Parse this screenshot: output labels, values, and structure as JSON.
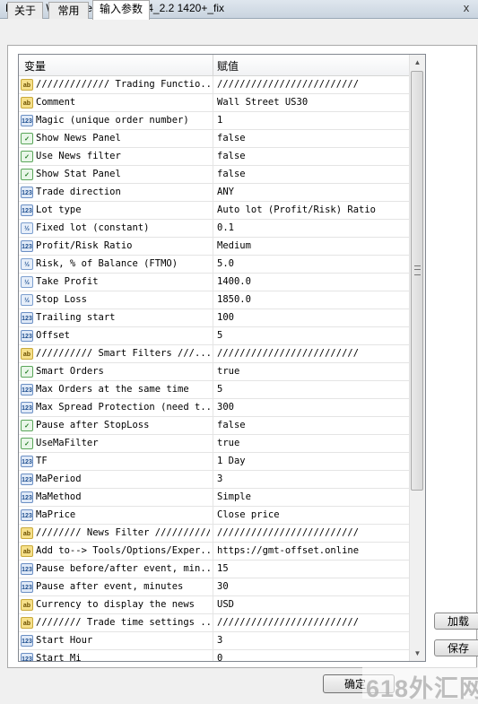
{
  "window": {
    "title": "Expert - WallStreetScalperMT4_2.2 1420+_fix",
    "close_glyph": "x"
  },
  "tabs": [
    {
      "label": "关于"
    },
    {
      "label": "常用"
    },
    {
      "label": "输入参数"
    }
  ],
  "grid": {
    "headers": {
      "variable": "变量",
      "value": "赋值"
    },
    "rows": [
      {
        "type": "ab",
        "icon": "ab",
        "name": "///////////// Trading Functio...",
        "value": "/////////////////////////"
      },
      {
        "type": "ab",
        "icon": "ab",
        "name": "Comment",
        "value": "Wall Street US30"
      },
      {
        "type": "int",
        "icon": "123",
        "name": "Magic (unique order number)",
        "value": "1"
      },
      {
        "type": "bool",
        "icon": "✓",
        "name": "Show News Panel",
        "value": "false"
      },
      {
        "type": "bool",
        "icon": "✓",
        "name": "Use News filter",
        "value": "false"
      },
      {
        "type": "bool",
        "icon": "✓",
        "name": "Show Stat Panel",
        "value": "false"
      },
      {
        "type": "int",
        "icon": "123",
        "name": "Trade direction",
        "value": "ANY"
      },
      {
        "type": "int",
        "icon": "123",
        "name": "Lot type",
        "value": "Auto lot (Profit/Risk) Ratio"
      },
      {
        "type": "dbl",
        "icon": "½",
        "name": "Fixed lot (constant)",
        "value": "0.1"
      },
      {
        "type": "int",
        "icon": "123",
        "name": "Profit/Risk Ratio",
        "value": "Medium"
      },
      {
        "type": "dbl",
        "icon": "½",
        "name": "Risk, % of Balance (FTMO)",
        "value": "5.0"
      },
      {
        "type": "dbl",
        "icon": "½",
        "name": "Take Profit",
        "value": "1400.0"
      },
      {
        "type": "dbl",
        "icon": "½",
        "name": "Stop Loss",
        "value": "1850.0"
      },
      {
        "type": "int",
        "icon": "123",
        "name": "Trailing start",
        "value": "100"
      },
      {
        "type": "int",
        "icon": "123",
        "name": "Offset",
        "value": "5"
      },
      {
        "type": "ab",
        "icon": "ab",
        "name": "////////// Smart Filters ///...",
        "value": "/////////////////////////"
      },
      {
        "type": "bool",
        "icon": "✓",
        "name": "Smart Orders",
        "value": "true"
      },
      {
        "type": "int",
        "icon": "123",
        "name": "Max Orders at the same time",
        "value": "5"
      },
      {
        "type": "int",
        "icon": "123",
        "name": "Max Spread Protection (need t...",
        "value": "300"
      },
      {
        "type": "bool",
        "icon": "✓",
        "name": "Pause after StopLoss",
        "value": "false"
      },
      {
        "type": "bool",
        "icon": "✓",
        "name": "UseMaFilter",
        "value": "true"
      },
      {
        "type": "int",
        "icon": "123",
        "name": "TF",
        "value": "1 Day"
      },
      {
        "type": "int",
        "icon": "123",
        "name": "MaPeriod",
        "value": "3"
      },
      {
        "type": "int",
        "icon": "123",
        "name": "MaMethod",
        "value": "Simple"
      },
      {
        "type": "int",
        "icon": "123",
        "name": "MaPrice",
        "value": "Close price"
      },
      {
        "type": "ab",
        "icon": "ab",
        "name": "//////// News Filter //////////",
        "value": "/////////////////////////"
      },
      {
        "type": "ab",
        "icon": "ab",
        "name": "Add to--> Tools/Options/Exper...",
        "value": "https://gmt-offset.online"
      },
      {
        "type": "int",
        "icon": "123",
        "name": "Pause before/after event, min...",
        "value": "15"
      },
      {
        "type": "int",
        "icon": "123",
        "name": "Pause after event, minutes",
        "value": "30"
      },
      {
        "type": "ab",
        "icon": "ab",
        "name": "Currency to display the news",
        "value": "USD"
      },
      {
        "type": "ab",
        "icon": "ab",
        "name": "//////// Trade time settings ...",
        "value": "/////////////////////////"
      },
      {
        "type": "int",
        "icon": "123",
        "name": "Start Hour",
        "value": "3"
      },
      {
        "type": "int",
        "icon": "123",
        "name": "Start Mi",
        "value": "0"
      }
    ]
  },
  "scrollbar": {
    "up_glyph": "▲",
    "down_glyph": "▼"
  },
  "buttons": {
    "load": "加载",
    "save": "保存",
    "ok": "确定"
  },
  "watermark": "618外汇网"
}
